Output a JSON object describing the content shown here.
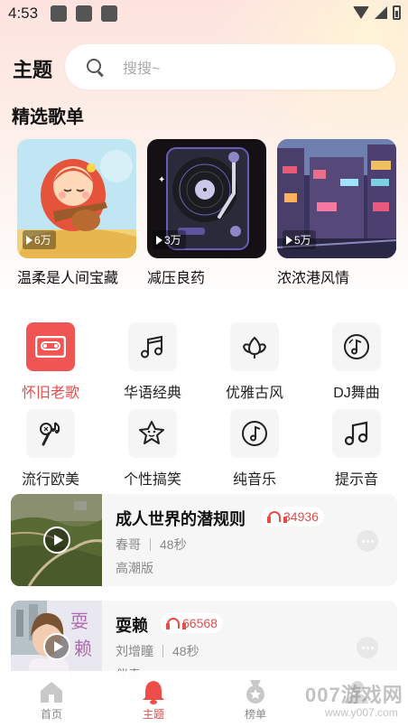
{
  "status_bar": {
    "time": "4:53"
  },
  "header": {
    "title": "主题",
    "search_placeholder": "搜搜~"
  },
  "section": {
    "title": "精选歌单"
  },
  "playlists": [
    {
      "name": "温柔是人间宝藏",
      "count": "6万"
    },
    {
      "name": "减压良药",
      "count": "3万"
    },
    {
      "name": "浓浓港风情",
      "count": "5万"
    }
  ],
  "categories": [
    {
      "label": "怀旧老歌",
      "icon": "cassette-icon",
      "active": true
    },
    {
      "label": "华语经典",
      "icon": "music-notes-icon",
      "active": false
    },
    {
      "label": "优雅古风",
      "icon": "flower-icon",
      "active": false
    },
    {
      "label": "DJ舞曲",
      "icon": "vinyl-icon",
      "active": false
    },
    {
      "label": "流行欧美",
      "icon": "microphone-icon",
      "active": false
    },
    {
      "label": "个性搞笑",
      "icon": "star-face-icon",
      "active": false
    },
    {
      "label": "纯音乐",
      "icon": "music-disc-icon",
      "active": false
    },
    {
      "label": "提示音",
      "icon": "music-note-icon",
      "active": false
    }
  ],
  "songs": [
    {
      "title": "成人世界的潜规则",
      "plays": "34936",
      "artist": "春哥",
      "duration": "48秒",
      "tag": "高潮版"
    },
    {
      "title": "耍赖",
      "plays": "66568",
      "artist": "刘增瞳",
      "duration": "48秒",
      "tag": "伴奏"
    }
  ],
  "bottom_nav": [
    {
      "label": "首页",
      "icon": "home-icon",
      "active": false
    },
    {
      "label": "主题",
      "icon": "bell-icon",
      "active": true
    },
    {
      "label": "榜单",
      "icon": "medal-icon",
      "active": false
    },
    {
      "label": "",
      "icon": "profile-icon",
      "active": false
    }
  ],
  "watermark": {
    "text": "007游戏网",
    "sub": "www.y007.com"
  },
  "colors": {
    "accent": "#e74c4b",
    "active_tile": "#f15553"
  }
}
